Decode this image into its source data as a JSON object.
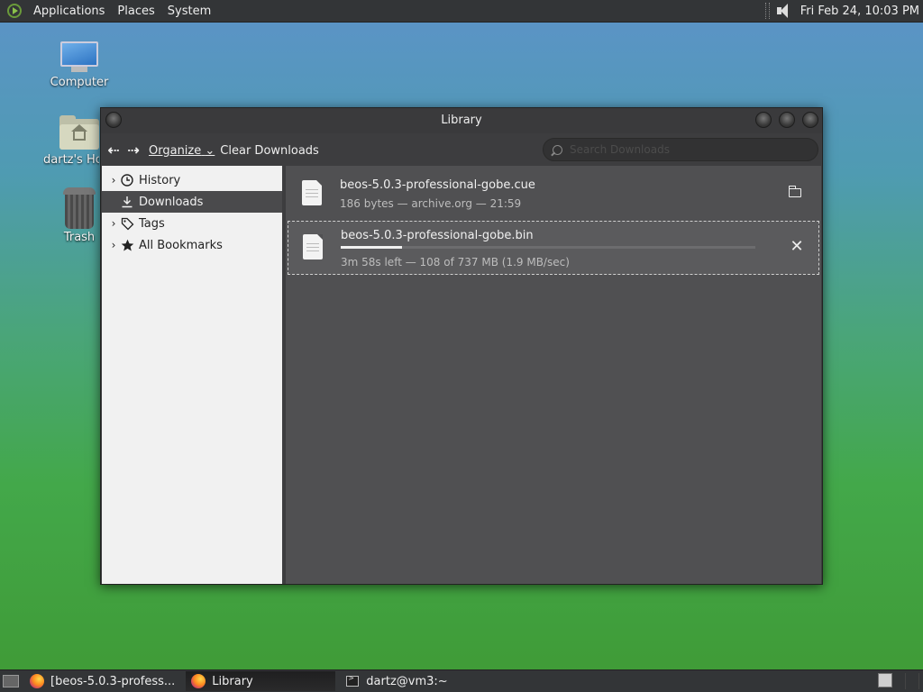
{
  "top_panel": {
    "menus": [
      "Applications",
      "Places",
      "System"
    ],
    "clock": "Fri Feb 24, 10:03 PM",
    "icons": [
      "distro-logo-icon",
      "volume-icon"
    ]
  },
  "desktop": {
    "icons": [
      {
        "label": "Computer",
        "icon": "computer-icon"
      },
      {
        "label": "dartz's Ho",
        "icon": "home-folder-icon"
      },
      {
        "label": "Trash",
        "icon": "trash-icon"
      }
    ]
  },
  "window": {
    "title": "Library",
    "toolbar": {
      "back": "back-arrow-icon",
      "forward": "forward-arrow-icon",
      "organize": "Organize",
      "organize_caret": "⌄",
      "clear_downloads": "Clear Downloads",
      "search_placeholder": "Search Downloads"
    },
    "sidebar": {
      "items": [
        {
          "label": "History",
          "expandable": true,
          "icon": "clock-icon"
        },
        {
          "label": "Downloads",
          "expandable": false,
          "icon": "download-icon",
          "selected": true
        },
        {
          "label": "Tags",
          "expandable": true,
          "icon": "tag-icon"
        },
        {
          "label": "All Bookmarks",
          "expandable": true,
          "icon": "star-icon"
        }
      ]
    },
    "downloads": [
      {
        "name": "beos-5.0.3-professional-gobe.cue",
        "status": "186 bytes — archive.org — 21:59",
        "action_icon": "folder-icon"
      },
      {
        "name": "beos-5.0.3-professional-gobe.bin",
        "status": "3m 58s left — 108 of 737 MB (1.9 MB/sec)",
        "progress": 0.147,
        "action_icon": "cancel-icon",
        "close_glyph": "✕"
      }
    ]
  },
  "bottom_panel": {
    "tasks": [
      {
        "label": "[beos-5.0.3-profess...",
        "icon": "firefox-icon"
      },
      {
        "label": "Library",
        "icon": "firefox-icon",
        "active": true
      },
      {
        "label": "dartz@vm3:~",
        "icon": "terminal-icon"
      }
    ]
  }
}
